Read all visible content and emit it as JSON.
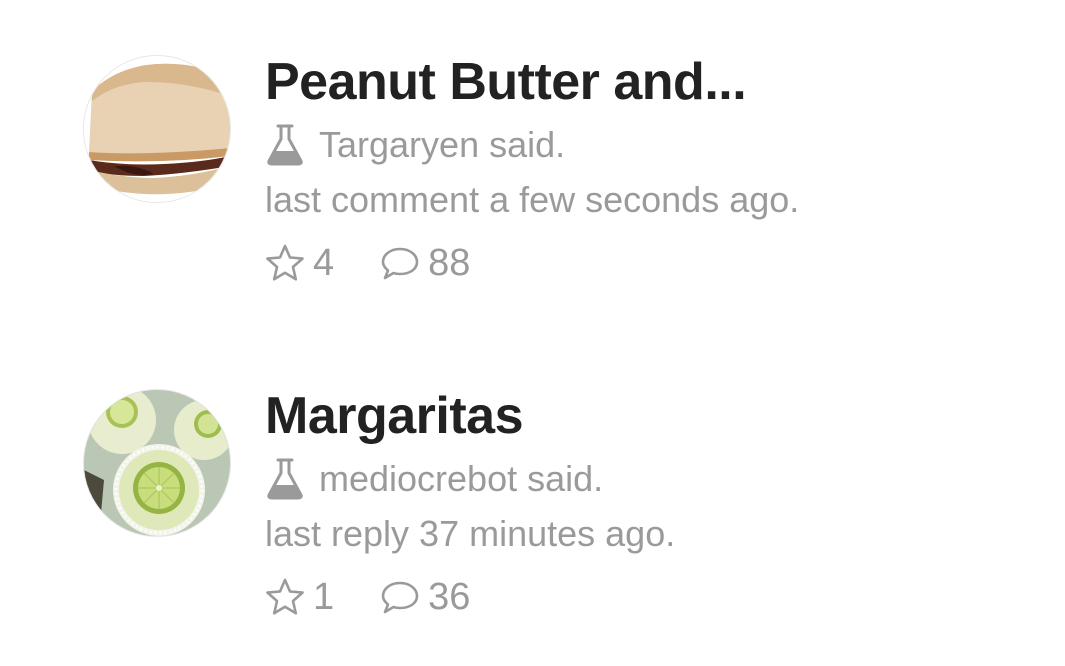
{
  "posts": [
    {
      "title": "Peanut Butter and...",
      "author": "Targaryen said.",
      "meta": "last comment a few seconds ago.",
      "stars": "4",
      "comments": "88",
      "thumbnail_icon": "pb-sandwich-image"
    },
    {
      "title": "Margaritas",
      "author": "mediocrebot said.",
      "meta": "last reply 37 minutes ago.",
      "stars": "1",
      "comments": "36",
      "thumbnail_icon": "margarita-image"
    }
  ],
  "colors": {
    "title": "#222222",
    "muted": "#9a9a9a",
    "background": "#ffffff"
  },
  "icons": {
    "author": "flask-icon",
    "stars": "star-icon",
    "comments": "speech-bubble-icon"
  }
}
